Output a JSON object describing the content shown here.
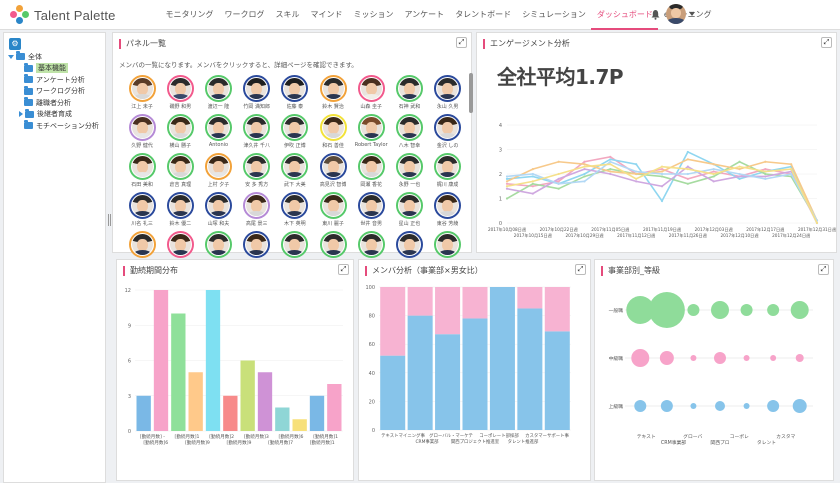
{
  "header": {
    "app_name": "Talent Palette",
    "nav": [
      "モニタリング",
      "ワークログ",
      "スキル",
      "マインド",
      "ミッション",
      "アンケート",
      "タレントボード",
      "シミュレーション",
      "ダッシュボード",
      "e-ラーニング"
    ],
    "active_nav": "ダッシュボード",
    "icons": [
      "bell-icon",
      "user-avatar",
      "caret-down-icon"
    ]
  },
  "sidebar": {
    "root": "全体",
    "items": [
      {
        "label": "基本機能",
        "selected": true
      },
      {
        "label": "アンケート分析",
        "selected": false
      },
      {
        "label": "ワークログ分析",
        "selected": false
      },
      {
        "label": "離職者分析",
        "selected": false
      },
      {
        "label": "後継者育成",
        "selected": false,
        "expandable": true
      },
      {
        "label": "モチベーション分析",
        "selected": false
      }
    ]
  },
  "panels": {
    "members": {
      "title": "パネル一覧",
      "description": "メンバの一覧になります。メンバをクリックすると、詳細ページを確認できます。",
      "members": [
        {
          "name": "江上 未子",
          "ring": "#f2a23a",
          "hair": "#5a3c28",
          "body": "#d8d8d8"
        },
        {
          "name": "磯野 和男",
          "ring": "#f25a8c",
          "hair": "#2b2b2b",
          "body": "#3a4a6a"
        },
        {
          "name": "渡辺一 隆",
          "ring": "#56c96a",
          "hair": "#2b2b2b",
          "body": "#2a3550"
        },
        {
          "name": "竹岡 満知郎",
          "ring": "#2b4a9c",
          "hair": "#1f1f1f",
          "body": "#2a3550"
        },
        {
          "name": "佐藤 泰",
          "ring": "#2b4a9c",
          "hair": "#1f1f1f",
          "body": "#2a3550"
        },
        {
          "name": "鈴木 賢治",
          "ring": "#f2a23a",
          "hair": "#2b2b2b",
          "body": "#2a3550"
        },
        {
          "name": "山森 圭子",
          "ring": "#f25a8c",
          "hair": "#4a3020",
          "body": "#f0eee8"
        },
        {
          "name": "石神 武和",
          "ring": "#56c96a",
          "hair": "#2b2b2b",
          "body": "#2a3550"
        },
        {
          "name": "永山 久男",
          "ring": "#2b4a9c",
          "hair": "#2b2b2b",
          "body": "#2a3550"
        },
        {
          "name": "久野 健代",
          "ring": "#b58ad6",
          "hair": "#4a3020",
          "body": "#e6e6e6"
        },
        {
          "name": "横山 勝子",
          "ring": "#56c96a",
          "hair": "#3a2818",
          "body": "#d8d8d8"
        },
        {
          "name": "Antonio",
          "ring": "#56c96a",
          "hair": "#2b2b2b",
          "body": "#2a3550"
        },
        {
          "name": "津久井 千八",
          "ring": "#56c96a",
          "hair": "#2b2b2b",
          "body": "#2a3550"
        },
        {
          "name": "伊吹 正博",
          "ring": "#56c96a",
          "hair": "#2b2b2b",
          "body": "#2a3550"
        },
        {
          "name": "和石 善佳",
          "ring": "#f2e23a",
          "hair": "#3a2818",
          "body": "#d8d8d8"
        },
        {
          "name": "Robert Taylor",
          "ring": "#56c96a",
          "hair": "#7a4a2a",
          "body": "#2a3550"
        },
        {
          "name": "八木 智幸",
          "ring": "#56c96a",
          "hair": "#2b2b2b",
          "body": "#2a3550"
        },
        {
          "name": "金沢 しの",
          "ring": "#2b4a9c",
          "hair": "#3a2818",
          "body": "#d8d8d8"
        },
        {
          "name": "石田 美和",
          "ring": "#56c96a",
          "hair": "#3a2818",
          "body": "#e6e6e6"
        },
        {
          "name": "倉吉 真理",
          "ring": "#56c96a",
          "hair": "#3a2818",
          "body": "#d8d8d8"
        },
        {
          "name": "上村 夕子",
          "ring": "#f2a23a",
          "hair": "#3a2818",
          "body": "#e6e6e6"
        },
        {
          "name": "安 多 秀方",
          "ring": "#56c96a",
          "hair": "#2b2b2b",
          "body": "#2a3550"
        },
        {
          "name": "武下 大美",
          "ring": "#56c96a",
          "hair": "#2b2b2b",
          "body": "#2a3550"
        },
        {
          "name": "高見沢 智博",
          "ring": "#2b4a9c",
          "hair": "#5a4a3a",
          "body": "#2a3550"
        },
        {
          "name": "岡瀬 香花",
          "ring": "#56c96a",
          "hair": "#3a2818",
          "body": "#d8d8d8"
        },
        {
          "name": "永野 一也",
          "ring": "#56c96a",
          "hair": "#2b2b2b",
          "body": "#2a3550"
        },
        {
          "name": "梶川 康成",
          "ring": "#56c96a",
          "hair": "#2b2b2b",
          "body": "#2a3550"
        },
        {
          "name": "川名 礼三",
          "ring": "#2b4a9c",
          "hair": "#2b2b2b",
          "body": "#2a3550"
        },
        {
          "name": "鈴木 優二",
          "ring": "#2b4a9c",
          "hair": "#2b2b2b",
          "body": "#2a3550"
        },
        {
          "name": "山塚 和夫",
          "ring": "#2b4a9c",
          "hair": "#2b2b2b",
          "body": "#2a3550"
        },
        {
          "name": "高尾 景三",
          "ring": "#b58ad6",
          "hair": "#3a2818",
          "body": "#d8d8d8"
        },
        {
          "name": "木下 英明",
          "ring": "#2b4a9c",
          "hair": "#2b2b2b",
          "body": "#2a3550"
        },
        {
          "name": "東川 麗子",
          "ring": "#56c96a",
          "hair": "#3a2818",
          "body": "#d8d8d8"
        },
        {
          "name": "世井 音男",
          "ring": "#2b4a9c",
          "hair": "#2b2b2b",
          "body": "#2a3550"
        },
        {
          "name": "星山 正也",
          "ring": "#56c96a",
          "hair": "#2b2b2b",
          "body": "#2a3550"
        },
        {
          "name": "東谷 芳綾",
          "ring": "#2b4a9c",
          "hair": "#3a2818",
          "body": "#d8d8d8"
        },
        {
          "name": "",
          "ring": "#f2a23a",
          "hair": "#2b2b2b",
          "body": "#2a3550"
        },
        {
          "name": "",
          "ring": "#f25a8c",
          "hair": "#3a2818",
          "body": "#2a3550"
        },
        {
          "name": "",
          "ring": "#56c96a",
          "hair": "#2b2b2b",
          "body": "#2a3550"
        },
        {
          "name": "",
          "ring": "#2b4a9c",
          "hair": "#3a2818",
          "body": "#2a3550"
        },
        {
          "name": "",
          "ring": "#56c96a",
          "hair": "#2b2b2b",
          "body": "#2a3550"
        },
        {
          "name": "",
          "ring": "#56c96a",
          "hair": "#2b2b2b",
          "body": "#2a3550"
        },
        {
          "name": "",
          "ring": "#56c96a",
          "hair": "#2b2b2b",
          "body": "#2a3550"
        },
        {
          "name": "",
          "ring": "#2b4a9c",
          "hair": "#2b2b2b",
          "body": "#2a3550"
        },
        {
          "name": "",
          "ring": "#56c96a",
          "hair": "#2b2b2b",
          "body": "#2a3550"
        }
      ]
    },
    "engagement": {
      "title": "エンゲージメント分析",
      "big_label": "全社平均1.7P"
    },
    "tenure": {
      "title": "勤続期間分布"
    },
    "member_ratio": {
      "title": "メンバ分析（事業部×男女比）"
    },
    "dept_grade": {
      "title": "事業部別_等級"
    }
  },
  "chart_data": [
    {
      "type": "line",
      "name": "engagement",
      "ylim": [
        0,
        4
      ],
      "yticks": [
        0,
        1,
        2,
        3,
        4
      ],
      "x": [
        "2017年10月08日週",
        "2017年10月15日週",
        "2017年10月22日週",
        "2017年10月29日週",
        "2017年11月05日週",
        "2017年11月12日週",
        "2017年11月19日週",
        "2017年11月26日週",
        "2017年12月03日週",
        "2017年12月10日週",
        "2017年12月17日週",
        "2017年12月24日週",
        "2017年12月31日週"
      ],
      "x_labels_visible": [
        "2017年10月08日週",
        "2017年10月22日週",
        "2017年11月05日週",
        "2017年11月19日週",
        "2017年12月03日週",
        "2017年12月17日週",
        "2017年12月31日週"
      ],
      "x_labels_visible_row2": [
        "2017年10月15日週",
        "2017年10月29日週",
        "2017年11月12日週",
        "2017年11月26日週",
        "2017年12月10日週",
        "2017年12月24日週"
      ],
      "series": [
        {
          "color": "#f2a8c0",
          "values": [
            1.6,
            1.5,
            1.7,
            2.5,
            2.7,
            2.0,
            2.2,
            1.8,
            2.1,
            1.9,
            2.2,
            2.0,
            0.1
          ]
        },
        {
          "color": "#8fd6f0",
          "values": [
            1.8,
            1.9,
            1.6,
            2.0,
            2.6,
            2.4,
            0.9,
            2.9,
            2.4,
            1.8,
            2.1,
            2.3,
            0.0
          ]
        },
        {
          "color": "#a6dba0",
          "values": [
            1.0,
            1.6,
            1.4,
            1.9,
            2.2,
            2.0,
            1.9,
            1.6,
            1.9,
            2.5,
            2.0,
            1.9,
            0.1
          ]
        },
        {
          "color": "#f7c98a",
          "values": [
            1.7,
            2.2,
            2.5,
            2.4,
            2.1,
            2.0,
            2.1,
            2.6,
            2.4,
            2.2,
            2.5,
            2.4,
            0.1
          ]
        },
        {
          "color": "#cfa8e0",
          "values": [
            1.4,
            1.2,
            1.8,
            2.2,
            2.0,
            1.7,
            1.5,
            2.3,
            1.7,
            1.9,
            1.9,
            2.1,
            0.0
          ]
        },
        {
          "color": "#b2d8f5",
          "values": [
            1.9,
            2.0,
            1.6,
            1.7,
            2.5,
            2.1,
            2.0,
            2.0,
            2.2,
            2.0,
            1.8,
            2.0,
            0.1
          ]
        },
        {
          "color": "#f5e08a",
          "values": [
            1.5,
            1.7,
            2.0,
            2.3,
            2.4,
            1.8,
            2.3,
            2.2,
            2.0,
            2.3,
            2.1,
            2.2,
            0.0
          ]
        }
      ]
    },
    {
      "type": "bar",
      "name": "tenure",
      "ylim": [
        0,
        12
      ],
      "yticks": [
        0,
        3,
        6,
        9,
        12
      ],
      "values": [
        3,
        12,
        10,
        5,
        12,
        3,
        6,
        5,
        2,
        1,
        3,
        4
      ],
      "colors": [
        "#7ab8e6",
        "#f7a3c9",
        "#8fe09a",
        "#ffc98a",
        "#7ee0f2",
        "#f78a8a",
        "#c9e07a",
        "#cf92d6",
        "#8fd6d6",
        "#f7e07a",
        "#7ab8e6",
        "#f7a3c9"
      ],
      "x_labels_row1": [
        "[勤続月数] -",
        "[勤続月数]1",
        "[勤続月数]2",
        "[勤続月数]3",
        "[勤続月数]6",
        "[勤続月数]1"
      ],
      "x_labels_row2": [
        "[勤続月数]6",
        "[勤続月数]9",
        "[勤続月数]9",
        "[勤続月数]7",
        "[勤続月数]1"
      ]
    },
    {
      "type": "bar",
      "stacked": true,
      "name": "member_ratio",
      "ylim": [
        0,
        100
      ],
      "yticks": [
        0,
        20,
        40,
        60,
        80,
        100
      ],
      "categories": [
        "テキストマイニング事",
        "CRM事業部",
        "グローバル・マーケテ",
        "関西プロジェクト推進室",
        "コーポレート部採部",
        "タレント推進部",
        "カスタマーサポート事",
        ""
      ],
      "x_labels_row1": [
        "テキストマイニング事",
        "グローバル・マーケテ",
        "コーポレート部採部",
        "カスタマーサポート事"
      ],
      "x_labels_row2": [
        "CRM事業部",
        "関西プロジェクト推進室",
        "タレント推進部"
      ],
      "series": [
        {
          "color": "#87c4ea",
          "values": [
            52,
            80,
            67,
            78,
            100,
            85,
            69
          ]
        },
        {
          "color": "#f7b3d2",
          "values": [
            48,
            20,
            33,
            22,
            0,
            15,
            31
          ]
        }
      ]
    },
    {
      "type": "scatter",
      "bubble": true,
      "name": "dept_grade",
      "y_categories": [
        "一般職",
        "中級職",
        "上級職"
      ],
      "x_labels_row1": [
        "テキスト",
        "グローバ",
        "コーポレ",
        "カスタマ"
      ],
      "x_labels_row2": [
        "CRM事業部",
        "関西プロ",
        "タレント"
      ],
      "rows": [
        {
          "color": "#8fdc9a",
          "sizes": [
            14,
            18,
            6,
            9,
            6,
            6,
            9
          ]
        },
        {
          "color": "#f7a3c9",
          "sizes": [
            9,
            7,
            3,
            6,
            3,
            3,
            4
          ]
        },
        {
          "color": "#87c4ea",
          "sizes": [
            6,
            6,
            3,
            5,
            3,
            6,
            7
          ]
        }
      ]
    }
  ]
}
